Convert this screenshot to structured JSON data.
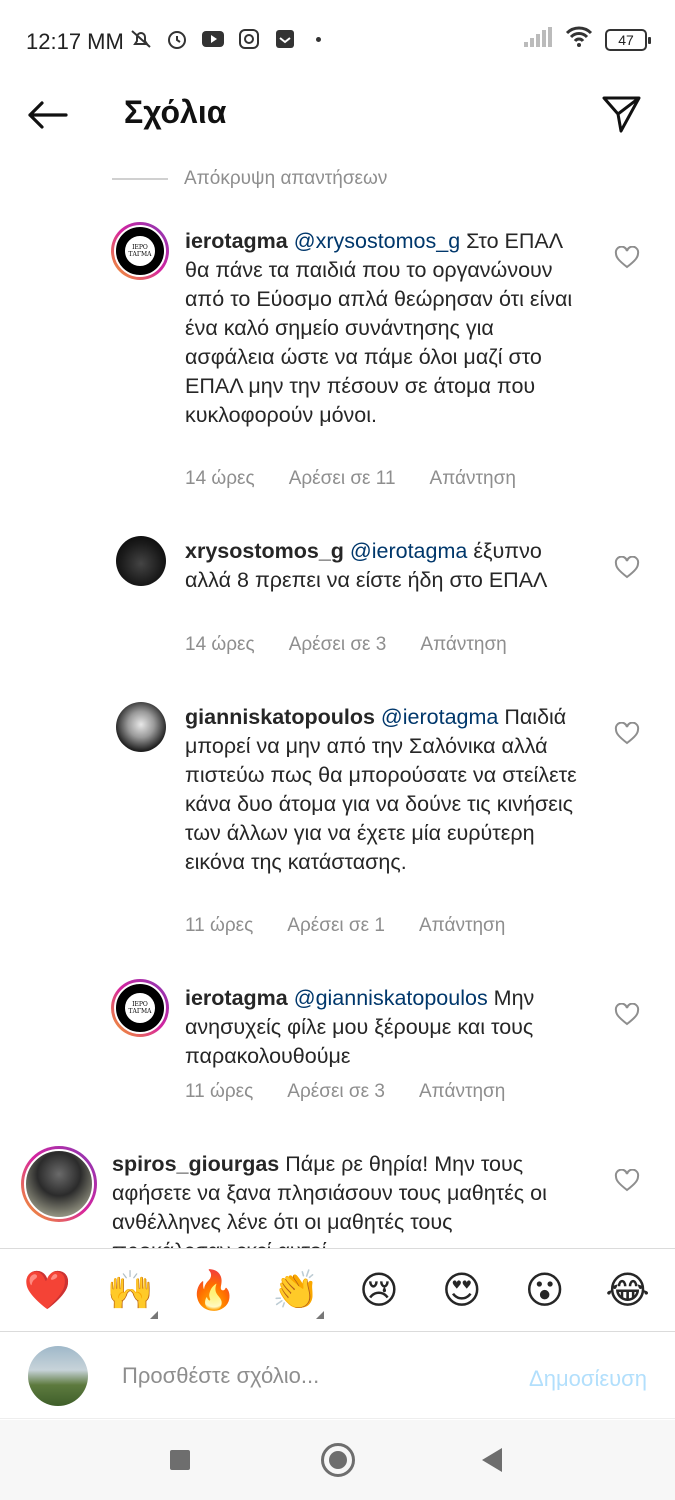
{
  "status_bar": {
    "time": "12:17 ΜΜ",
    "battery": "47",
    "icons": [
      "muted-bell-icon",
      "alarm-icon",
      "youtube-icon",
      "instagram-icon",
      "inbox-icon",
      "signal-icon",
      "wifi-icon"
    ]
  },
  "header": {
    "title": "Σχόλια",
    "back_icon": "arrow-left-icon",
    "send_icon": "send-icon"
  },
  "hide_replies": "Απόκρυψη απαντήσεων",
  "comments": [
    {
      "username": "ierotagma",
      "mention": "@xrysostomos_g",
      "text": " Στο ΕΠΑΛ θα πάνε τα παιδιά που το οργανώνουν από το Εύοσμο απλά θεώρησαν ότι είναι ένα καλό σημείο συνάντησης για ασφάλεια ώστε να πάμε όλοι μαζί στο ΕΠΑΛ μην την πέσουν σε άτομα που κυκλοφορούν μόνοι.",
      "time": "14 ώρες",
      "likes": "Αρέσει σε 11",
      "reply": "Απάντηση",
      "avatar_logo": "ΙΕΡΟ ΤΑΓΜΑ"
    },
    {
      "username": "xrysostomos_g",
      "mention": "@ierotagma",
      "text": " έξυπνο αλλά 8 πρεπει να είστε ήδη στο ΕΠΑΛ",
      "time": "14 ώρες",
      "likes": "Αρέσει σε 3",
      "reply": "Απάντηση"
    },
    {
      "username": "gianniskatopoulos",
      "mention": "@ierotagma",
      "text": " Παιδιά μπορεί να μην από την Σαλόνικα αλλά πιστεύω πως θα μπορούσατε να στείλετε κάνα δυο άτομα για να δούνε τις κινήσεις των άλλων για να έχετε μία ευρύτερη εικόνα της κατάστασης.",
      "time": "11 ώρες",
      "likes": "Αρέσει σε 1",
      "reply": "Απάντηση"
    },
    {
      "username": "ierotagma",
      "mention": "@gianniskatopoulos",
      "text": " Μην ανησυχείς φίλε μου ξέρουμε και τους παρακολουθούμε",
      "time": "11 ώρες",
      "likes": "Αρέσει σε 3",
      "reply": "Απάντηση",
      "avatar_logo": "ΙΕΡΟ ΤΑΓΜΑ"
    },
    {
      "username": "spiros_giourgas",
      "mention": "",
      "text": " Πάμε ρε θηρία! Μην τους αφήσετε να ξανα πλησιάσουν τους μαθητές οι ανθέλληνες λένε ότι οι μαθητές τους προκάλεσαν εκεί αυτοί"
    }
  ],
  "emoji_bar": [
    "❤️",
    "🙌",
    "🔥",
    "👏",
    "😢",
    "😍",
    "😮",
    "😂"
  ],
  "composer": {
    "placeholder": "Προσθέστε σχόλιο...",
    "post_label": "Δημοσίευση"
  },
  "colors": {
    "mention": "#00376b",
    "meta": "#8e8e8e",
    "post_disabled": "#b2dffc"
  }
}
